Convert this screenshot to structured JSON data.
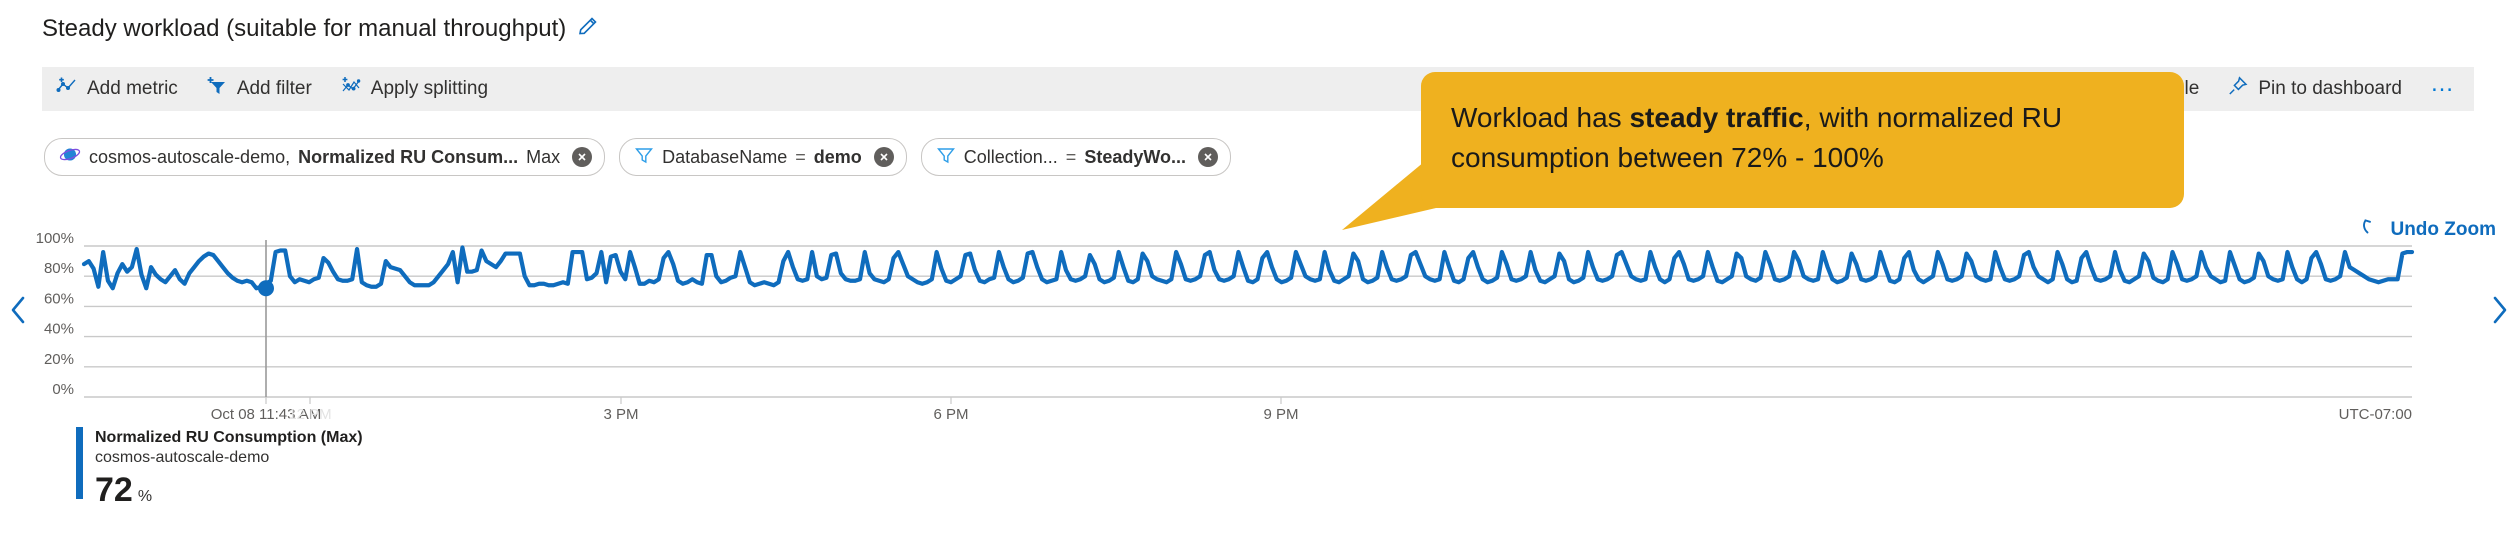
{
  "header": {
    "title": "Steady workload (suitable for manual throughput)",
    "edit_icon": "pencil-icon"
  },
  "toolbar": {
    "items": [
      {
        "label": "Add metric",
        "icon": "add-metric-icon"
      },
      {
        "label": "Add filter",
        "icon": "add-filter-icon"
      },
      {
        "label": "Apply splitting",
        "icon": "apply-splitting-icon"
      }
    ],
    "right_items": [
      {
        "label": "w alert rule",
        "icon": "alert-rule-icon",
        "truncated": true
      },
      {
        "label": "Pin to dashboard",
        "icon": "pin-icon"
      }
    ],
    "overflow_label": "…"
  },
  "pills": [
    {
      "icon": "cosmos-db-icon",
      "resource": "cosmos-autoscale-demo,",
      "metric": "Normalized RU Consum...",
      "aggregation": "Max",
      "remove_icon": "remove-icon"
    },
    {
      "icon": "filter-icon",
      "field": "DatabaseName",
      "operator": "=",
      "value": "demo",
      "remove_icon": "remove-icon"
    },
    {
      "icon": "filter-icon",
      "field": "Collection...",
      "operator": "=",
      "value": "SteadyWo...",
      "remove_icon": "remove-icon"
    }
  ],
  "chart_controls": {
    "undo_zoom_label": "Undo Zoom",
    "undo_zoom_icon": "undo-icon",
    "prev_icon": "chevron-left-icon",
    "next_icon": "chevron-right-icon"
  },
  "callout": {
    "text_before": "Workload has ",
    "text_bold": "steady traffic",
    "text_after": ", with normalized RU consumption between 72% - 100%",
    "background": "#efb11f"
  },
  "legend": {
    "metric_name": "Normalized RU Consumption (Max)",
    "resource_name": "cosmos-autoscale-demo",
    "value": "72",
    "unit": "%",
    "color": "#0f6cbd"
  },
  "chart_data": {
    "type": "line",
    "title": "Normalized RU Consumption (Max)",
    "xlabel": "",
    "ylabel": "",
    "ylim": [
      0,
      100
    ],
    "ytick_labels": [
      "100%",
      "80%",
      "60%",
      "40%",
      "20%",
      "0%"
    ],
    "ytick_values": [
      100,
      80,
      60,
      40,
      20,
      0
    ],
    "xtick_labels": [
      "Oct 08 11:43 AM",
      "12 PM",
      "3 PM",
      "6 PM",
      "9 PM"
    ],
    "xtick_faded": [
      "12 PM"
    ],
    "timezone_label": "UTC-07:00",
    "grid": true,
    "legend_position": "bottom-left",
    "cursor": {
      "x_label": "Oct 08 11:43 AM",
      "value": 72
    },
    "series": [
      {
        "name": "Normalized RU Consumption (Max)",
        "resource": "cosmos-autoscale-demo",
        "color": "#0f6cbd",
        "unit": "%",
        "values": [
          88,
          90,
          85,
          73,
          96,
          77,
          72,
          82,
          88,
          83,
          86,
          98,
          81,
          72,
          86,
          81,
          78,
          76,
          80,
          84,
          78,
          75,
          82,
          86,
          90,
          93,
          95,
          94,
          90,
          86,
          82,
          79,
          77,
          76,
          77,
          76,
          72,
          73,
          75,
          77,
          96,
          97,
          97,
          80,
          76,
          78,
          77,
          76,
          78,
          79,
          92,
          89,
          83,
          78,
          77,
          77,
          78,
          98,
          76,
          74,
          73,
          73,
          75,
          90,
          86,
          85,
          84,
          80,
          76,
          74,
          74,
          74,
          74,
          76,
          80,
          84,
          88,
          96,
          76,
          99,
          83,
          83,
          84,
          97,
          90,
          88,
          86,
          90,
          95,
          95,
          95,
          95,
          80,
          74,
          74,
          75,
          75,
          74,
          74,
          75,
          76,
          75,
          96,
          96,
          96,
          78,
          79,
          82,
          96,
          76,
          93,
          94,
          83,
          78,
          96,
          86,
          75,
          75,
          77,
          76,
          78,
          92,
          96,
          88,
          77,
          75,
          76,
          78,
          76,
          75,
          94,
          94,
          80,
          76,
          77,
          79,
          80,
          96,
          86,
          76,
          74,
          75,
          76,
          75,
          74,
          76,
          90,
          96,
          86,
          78,
          77,
          78,
          96,
          80,
          78,
          79,
          94,
          95,
          82,
          78,
          77,
          77,
          78,
          96,
          82,
          78,
          77,
          76,
          78,
          92,
          96,
          88,
          80,
          78,
          76,
          75,
          76,
          78,
          96,
          85,
          77,
          76,
          78,
          80,
          94,
          95,
          84,
          77,
          76,
          78,
          79,
          96,
          86,
          78,
          76,
          77,
          79,
          95,
          96,
          86,
          78,
          76,
          77,
          78,
          96,
          84,
          78,
          77,
          78,
          80,
          94,
          88,
          78,
          76,
          77,
          79,
          96,
          86,
          77,
          76,
          78,
          95,
          90,
          80,
          78,
          77,
          76,
          78,
          96,
          88,
          78,
          77,
          78,
          80,
          94,
          96,
          84,
          78,
          77,
          78,
          80,
          96,
          86,
          77,
          76,
          78,
          92,
          96,
          86,
          78,
          76,
          77,
          79,
          96,
          88,
          80,
          78,
          77,
          78,
          96,
          84,
          77,
          76,
          78,
          80,
          95,
          90,
          78,
          76,
          77,
          79,
          96,
          86,
          78,
          77,
          78,
          80,
          94,
          96,
          88,
          80,
          78,
          77,
          78,
          96,
          86,
          77,
          76,
          78,
          92,
          96,
          86,
          78,
          76,
          77,
          79,
          96,
          88,
          78,
          77,
          78,
          80,
          96,
          84,
          77,
          76,
          78,
          80,
          95,
          90,
          78,
          76,
          77,
          79,
          96,
          86,
          78,
          77,
          78,
          80,
          94,
          96,
          88,
          80,
          78,
          77,
          78,
          96,
          86,
          78,
          76,
          78,
          92,
          96,
          88,
          78,
          77,
          78,
          80,
          96,
          86,
          77,
          76,
          78,
          80,
          95,
          92,
          80,
          78,
          77,
          79,
          96,
          88,
          78,
          77,
          78,
          80,
          96,
          90,
          80,
          78,
          77,
          78,
          96,
          86,
          78,
          76,
          77,
          79,
          95,
          88,
          78,
          77,
          78,
          80,
          96,
          86,
          77,
          76,
          78,
          92,
          96,
          84,
          78,
          76,
          78,
          80,
          96,
          88,
          78,
          77,
          78,
          80,
          95,
          90,
          80,
          78,
          77,
          78,
          96,
          86,
          78,
          77,
          78,
          80,
          94,
          96,
          86,
          80,
          78,
          76,
          78,
          96,
          88,
          78,
          76,
          77,
          92,
          96,
          86,
          78,
          77,
          78,
          80,
          96,
          84,
          77,
          76,
          78,
          80,
          95,
          90,
          79,
          77,
          76,
          78,
          96,
          88,
          78,
          77,
          78,
          80,
          96,
          86,
          80,
          78,
          76,
          77,
          96,
          87,
          78,
          76,
          77,
          79,
          95,
          90,
          80,
          78,
          77,
          78,
          96,
          86,
          78,
          76,
          78,
          92,
          96,
          88,
          78,
          77,
          78,
          80,
          96,
          86,
          84,
          82,
          80,
          78,
          77,
          76,
          77,
          78,
          78,
          78,
          95,
          96,
          96
        ]
      }
    ]
  }
}
